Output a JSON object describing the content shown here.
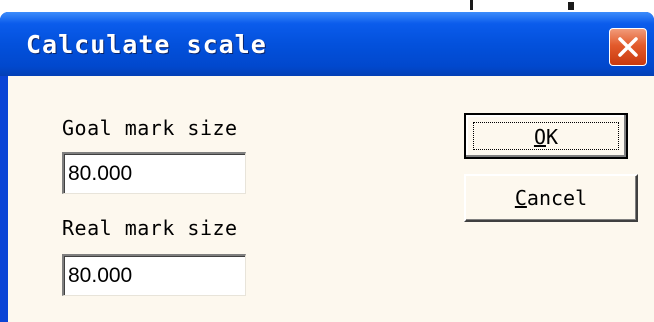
{
  "dialog": {
    "title": "Calculate scale",
    "close_icon": "close-icon"
  },
  "form": {
    "goal_label": "Goal mark size",
    "goal_value": "80.000",
    "real_label": "Real mark size",
    "real_value": "80.000"
  },
  "buttons": {
    "ok_mnemonic": "O",
    "ok_rest": "K",
    "cancel_mnemonic": "C",
    "cancel_rest": "ancel"
  },
  "colors": {
    "title_bar": "#0351dc",
    "close_button": "#e35b2c",
    "client_background": "#fdf8ee"
  }
}
